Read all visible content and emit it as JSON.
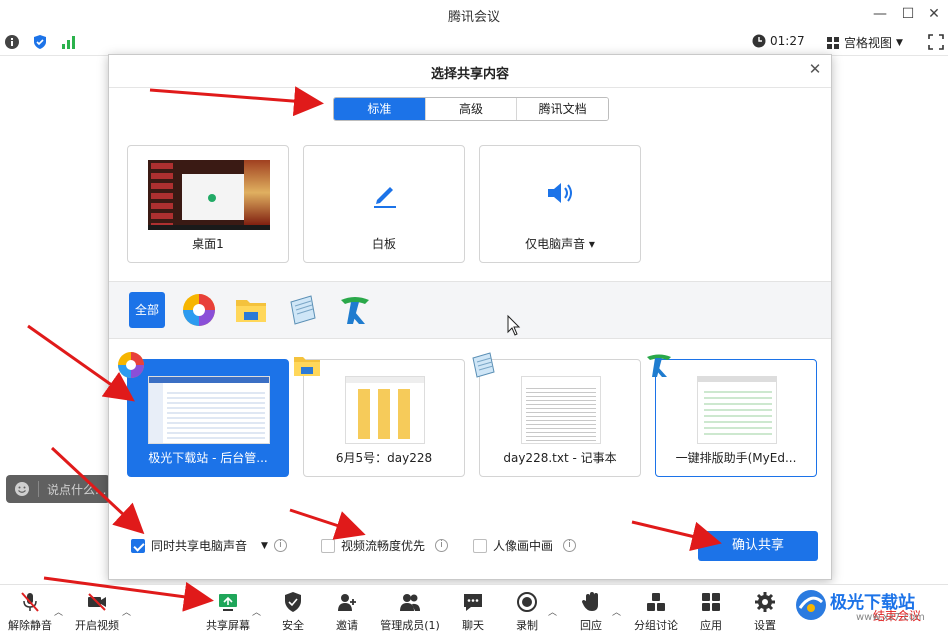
{
  "window": {
    "title": "腾讯会议",
    "minimize": "—",
    "maximize": "☐",
    "close": "✕"
  },
  "infobar": {
    "timer": "01:27",
    "view_mode": "宫格视图"
  },
  "chat": {
    "placeholder": "说点什么..."
  },
  "dialog": {
    "title": "选择共享内容",
    "close": "✕",
    "tabs": [
      {
        "label": "标准",
        "active": true
      },
      {
        "label": "高级",
        "active": false
      },
      {
        "label": "腾讯文档",
        "active": false
      }
    ],
    "sources": [
      {
        "label": "桌面1"
      },
      {
        "label": "白板"
      },
      {
        "label": "仅电脑声音 ▾"
      }
    ],
    "app_filter_all": "全部",
    "windows": [
      {
        "label": "极光下载站 - 后台管...",
        "selected": true
      },
      {
        "label": "6月5号：day228",
        "selected": false
      },
      {
        "label": "day228.txt - 记事本",
        "selected": false
      },
      {
        "label": "一键排版助手(MyEd...",
        "selected": false
      }
    ],
    "options": [
      {
        "label": "同时共享电脑声音",
        "checked": true
      },
      {
        "label": "视频流畅度优先",
        "checked": false
      },
      {
        "label": "人像画中画",
        "checked": false
      }
    ],
    "confirm": "确认共享"
  },
  "toolbar": {
    "items": [
      {
        "label": "解除静音"
      },
      {
        "label": "开启视频"
      },
      {
        "label": "共享屏幕"
      },
      {
        "label": "安全"
      },
      {
        "label": "邀请"
      },
      {
        "label": "管理成员(1)"
      },
      {
        "label": "聊天"
      },
      {
        "label": "录制"
      },
      {
        "label": "回应"
      },
      {
        "label": "分组讨论"
      },
      {
        "label": "应用"
      },
      {
        "label": "设置"
      },
      {
        "label": "结束会议"
      }
    ]
  },
  "watermark": {
    "text": "极光下载站",
    "url": "www.xz7.com"
  },
  "colors": {
    "accent": "#1c73e8",
    "annotation_arrow": "#e01a1a"
  }
}
